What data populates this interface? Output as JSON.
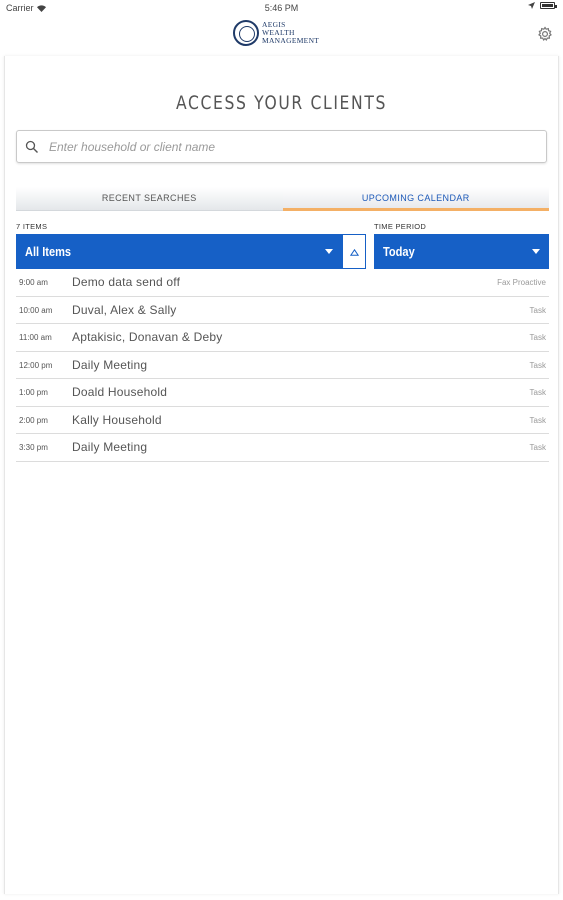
{
  "status_bar": {
    "carrier": "Carrier",
    "time": "5:46 PM"
  },
  "header": {
    "logo_line1": "AEGIS",
    "logo_line2": "WEALTH",
    "logo_line3": "MANAGEMENT"
  },
  "main": {
    "title": "ACCESS YOUR CLIENTS",
    "search_placeholder": "Enter household or client name",
    "tabs": [
      {
        "label": "RECENT SEARCHES"
      },
      {
        "label": "UPCOMING CALENDAR"
      }
    ],
    "items_count_label": "7 ITEMS",
    "items_filter_value": "All Items",
    "time_period_label": "TIME PERIOD",
    "time_period_value": "Today"
  },
  "calendar": [
    {
      "time": "9:00 am",
      "name": "Demo data send off",
      "type": "Fax Proactive"
    },
    {
      "time": "10:00 am",
      "name": "Duval, Alex & Sally",
      "type": "Task"
    },
    {
      "time": "11:00 am",
      "name": "Aptakisic, Donavan & Deby",
      "type": "Task"
    },
    {
      "time": "12:00 pm",
      "name": "Daily Meeting",
      "type": "Task"
    },
    {
      "time": "1:00 pm",
      "name": "Doald Household",
      "type": "Task"
    },
    {
      "time": "2:00 pm",
      "name": "Kally Household",
      "type": "Task"
    },
    {
      "time": "3:30 pm",
      "name": "Daily Meeting",
      "type": "Task"
    }
  ],
  "colors": {
    "accent": "#1660c6",
    "tab_underline": "#f4b066",
    "logo": "#1f3a68"
  }
}
